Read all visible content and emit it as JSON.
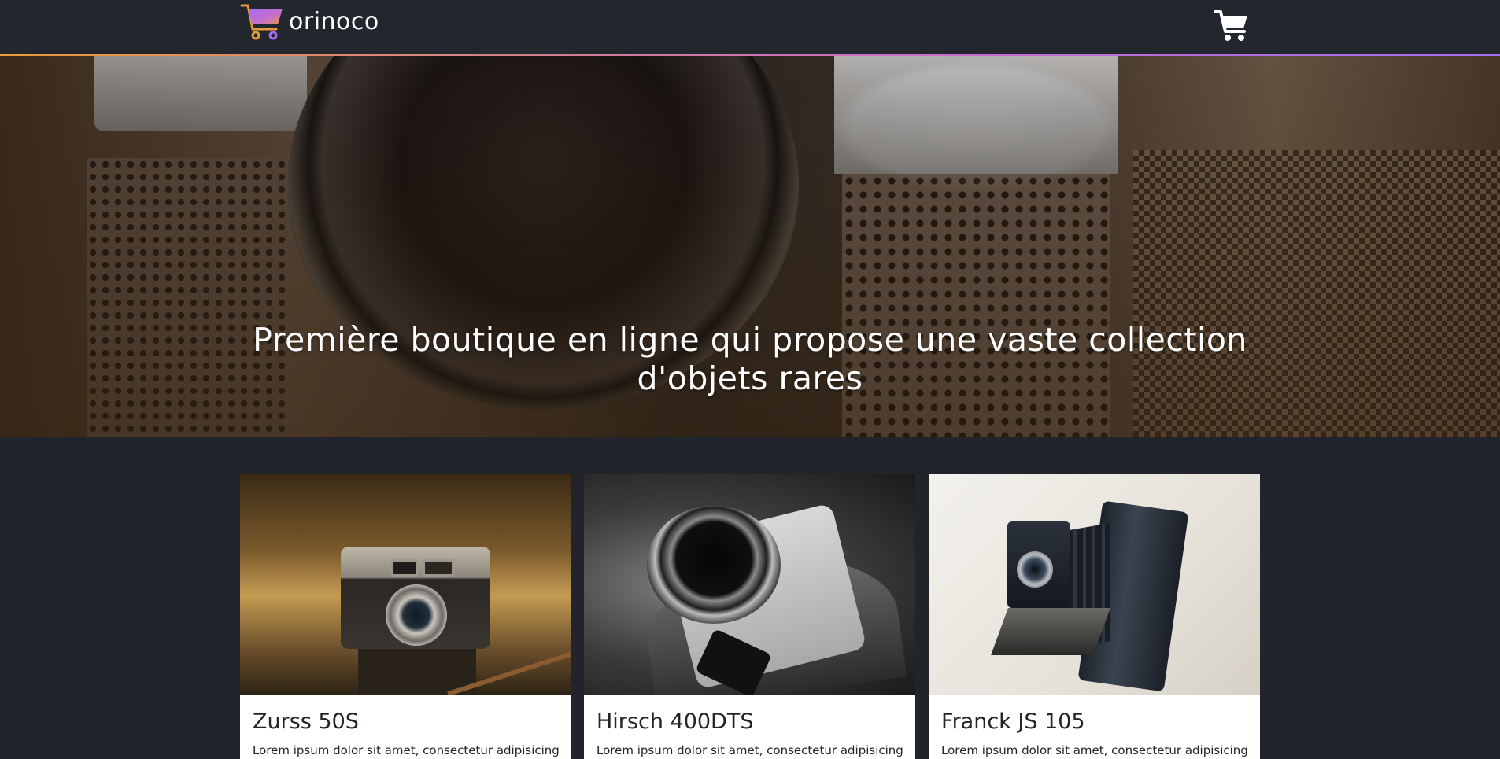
{
  "header": {
    "brand_name": "orinoco",
    "logo_icon": "shopping-cart-gradient-icon",
    "cart_icon": "shopping-cart-icon",
    "accent_gradient": [
      "#e79a3a",
      "#c86fc9",
      "#a36cf0"
    ],
    "background": "#22262d"
  },
  "hero": {
    "title": "Première boutique en ligne qui propose une vaste collection d'objets rares"
  },
  "products": [
    {
      "name": "Zurss 50S",
      "description": "Lorem ipsum dolor sit amet, consectetur adipisicing"
    },
    {
      "name": "Hirsch 400DTS",
      "description": "Lorem ipsum dolor sit amet, consectetur adipisicing"
    },
    {
      "name": "Franck JS 105",
      "description": "Lorem ipsum dolor sit amet, consectetur adipisicing"
    }
  ]
}
